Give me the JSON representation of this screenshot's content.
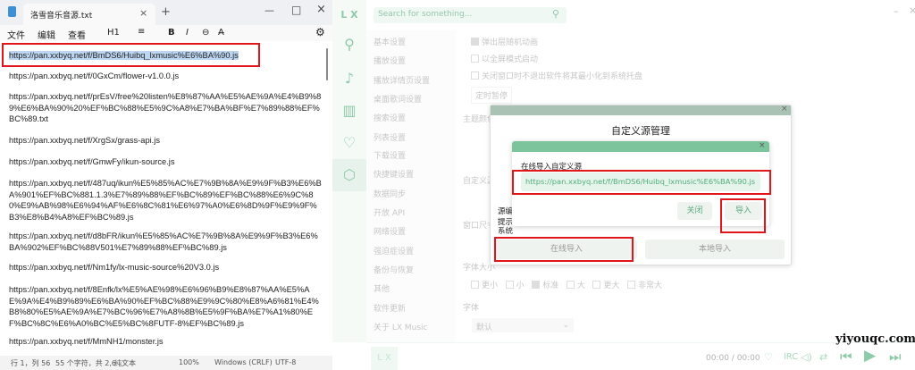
{
  "notepad": {
    "tab_title": "洛雪音乐音源.txt",
    "menu": [
      "文件",
      "编辑",
      "查看"
    ],
    "toolbar": {
      "heading": "H1",
      "list": "≡",
      "bold": "B",
      "italic": "I",
      "link": "⊖",
      "clear": "A̶"
    },
    "lines": [
      "https://pan.xxbyq.net/f/BmDS6/Huibq_lxmusic%E6%BA%90.js",
      "https://pan.xxbyq.net/f/0GxCm/flower-v1.0.0.js",
      "https://pan.xxbyq.net/f/prEsV/free%20listen%E8%87%AA%E5%AE%9A%E4%B9%89%E6%BA%90%20%EF%BC%88%E5%9C%A8%E7%BA%BF%E7%89%88%EF%BC%89.txt",
      "https://pan.xxbyq.net/f/XrgSx/grass-api.js",
      "https://pan.xxbyq.net/f/GmwFy/ikun-source.js",
      "https://pan.xxbyq.net/f/487uq/ikun%E5%85%AC%E7%9B%8A%E9%9F%B3%E6%BA%901%EF%BC%881.1.3%E7%89%88%EF%BC%89%EF%BC%88%E6%9C%80%E9%AB%98%E6%94%AF%E6%8C%81%E6%97%A0%E6%8D%9F%E9%9F%B3%E8%B4%A8%EF%BC%89.js",
      "https://pan.xxbyq.net/f/d8bFR/ikun%E5%85%AC%E7%9B%8A%E9%9F%B3%E6%BA%902%EF%BC%88V501%E7%89%88%EF%BC%89.js",
      "https://pan.xxbyq.net/f/Nm1fy/lx-music-source%20V3.0.js",
      "https://pan.xxbyq.net/f/8Enfk/lx%E5%AE%98%E6%96%B9%E8%87%AA%E5%AE%9A%E4%B9%89%E6%BA%90%EF%BC%88%E9%9C%80%E8%A6%81%E4%B8%80%E5%AE%9A%E7%BC%96%E7%A8%8B%E5%9F%BA%E7%A1%80%EF%BC%8C%E6%A0%BC%E5%BC%8FUTF-8%EF%BC%89.js",
      "https://pan.xxbyq.net/f/MmNH1/monster.js"
    ],
    "status": {
      "position": "行 1，列 56",
      "chars": "55 个字符，共 2,6",
      "type": "纯文本",
      "zoom": "100%",
      "eol": "Windows (CRLF)",
      "encoding": "UTF-8"
    }
  },
  "lx": {
    "logo": "L X",
    "search_placeholder": "Search for something...",
    "nav": [
      "基本设置",
      "播放设置",
      "播放详情页设置",
      "桌面歌词设置",
      "搜索设置",
      "列表设置",
      "下载设置",
      "快捷键设置",
      "数据同步",
      "开放 API",
      "网络设置",
      "强迫症设置",
      "备份与恢复",
      "其他",
      "软件更新",
      "关于 LX Music"
    ],
    "settings": {
      "opt1": "弹出层随机动画",
      "opt2": "以全屏模式启动",
      "opt3": "关闭窗口时不退出软件将其最小化到系统托盘",
      "timer": "定时暂停",
      "theme": "主题颜色",
      "custom_source": "自定义源",
      "window_size": "窗口尺寸",
      "font_size": "字体大小",
      "font_sizes": [
        "更小",
        "小",
        "标准",
        "大",
        "更大",
        "非常大"
      ],
      "font": "字体",
      "font_value": "默认"
    },
    "dialog": {
      "title": "自定义源管理",
      "hint1": "源编",
      "hint2": "提示",
      "hint3": "系统",
      "online": "在线导入",
      "local": "本地导入",
      "inner": {
        "label": "在线导入自定义源",
        "value": "https://pan.xxbyq.net/f/BmDS6/Huibq_lxmusic%E6%BA%90.js",
        "close": "关闭",
        "import": "导入"
      }
    },
    "player": {
      "time": "00:00 / 00:00",
      "logo": "L X"
    },
    "accent": "#4fae7a"
  },
  "watermark": "yiyouqc.com"
}
